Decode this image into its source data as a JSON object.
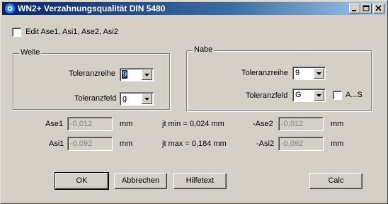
{
  "window": {
    "title": "WN2+ Verzahnungsqualität DIN 5480",
    "controls": {
      "minimize": "minimize-icon",
      "maximize": "maximize-icon",
      "close": "close-icon"
    }
  },
  "edit_checkbox": {
    "label": "Edit Ase1, Asi1, Ase2, Asi2",
    "checked": false
  },
  "welle": {
    "title": "Welle",
    "toleranzreihe_label": "Toleranzreihe",
    "toleranzreihe_value": "9",
    "toleranzfeld_label": "Toleranzfeld",
    "toleranzfeld_value": "g"
  },
  "nabe": {
    "title": "Nabe",
    "toleranzreihe_label": "Toleranzreihe",
    "toleranzreihe_value": "9",
    "toleranzfeld_label": "Toleranzfeld",
    "toleranzfeld_value": "G",
    "as_checkbox_label": "A...S",
    "as_checked": false
  },
  "values": {
    "ase1_label": "Ase1",
    "ase1_value": "-0,012",
    "ase1_unit": "mm",
    "asi1_label": "Asi1",
    "asi1_value": "-0,092",
    "asi1_unit": "mm",
    "jt_min": "jt min = 0,024 mm",
    "jt_max": "jt max = 0,184 mm",
    "ase2_label": "-Ase2",
    "ase2_value": "-0,012",
    "ase2_unit": "mm",
    "asi2_label": "-Asi2",
    "asi2_value": "-0,092",
    "asi2_unit": "mm"
  },
  "buttons": {
    "ok": "OK",
    "cancel": "Abbrechen",
    "help": "Hilfetext",
    "calc": "Calc"
  },
  "colors": {
    "titlebar_start": "#0a246a",
    "titlebar_end": "#a6caf0",
    "dialog_bg": "#d4d0c8",
    "selection": "#0a246a"
  }
}
